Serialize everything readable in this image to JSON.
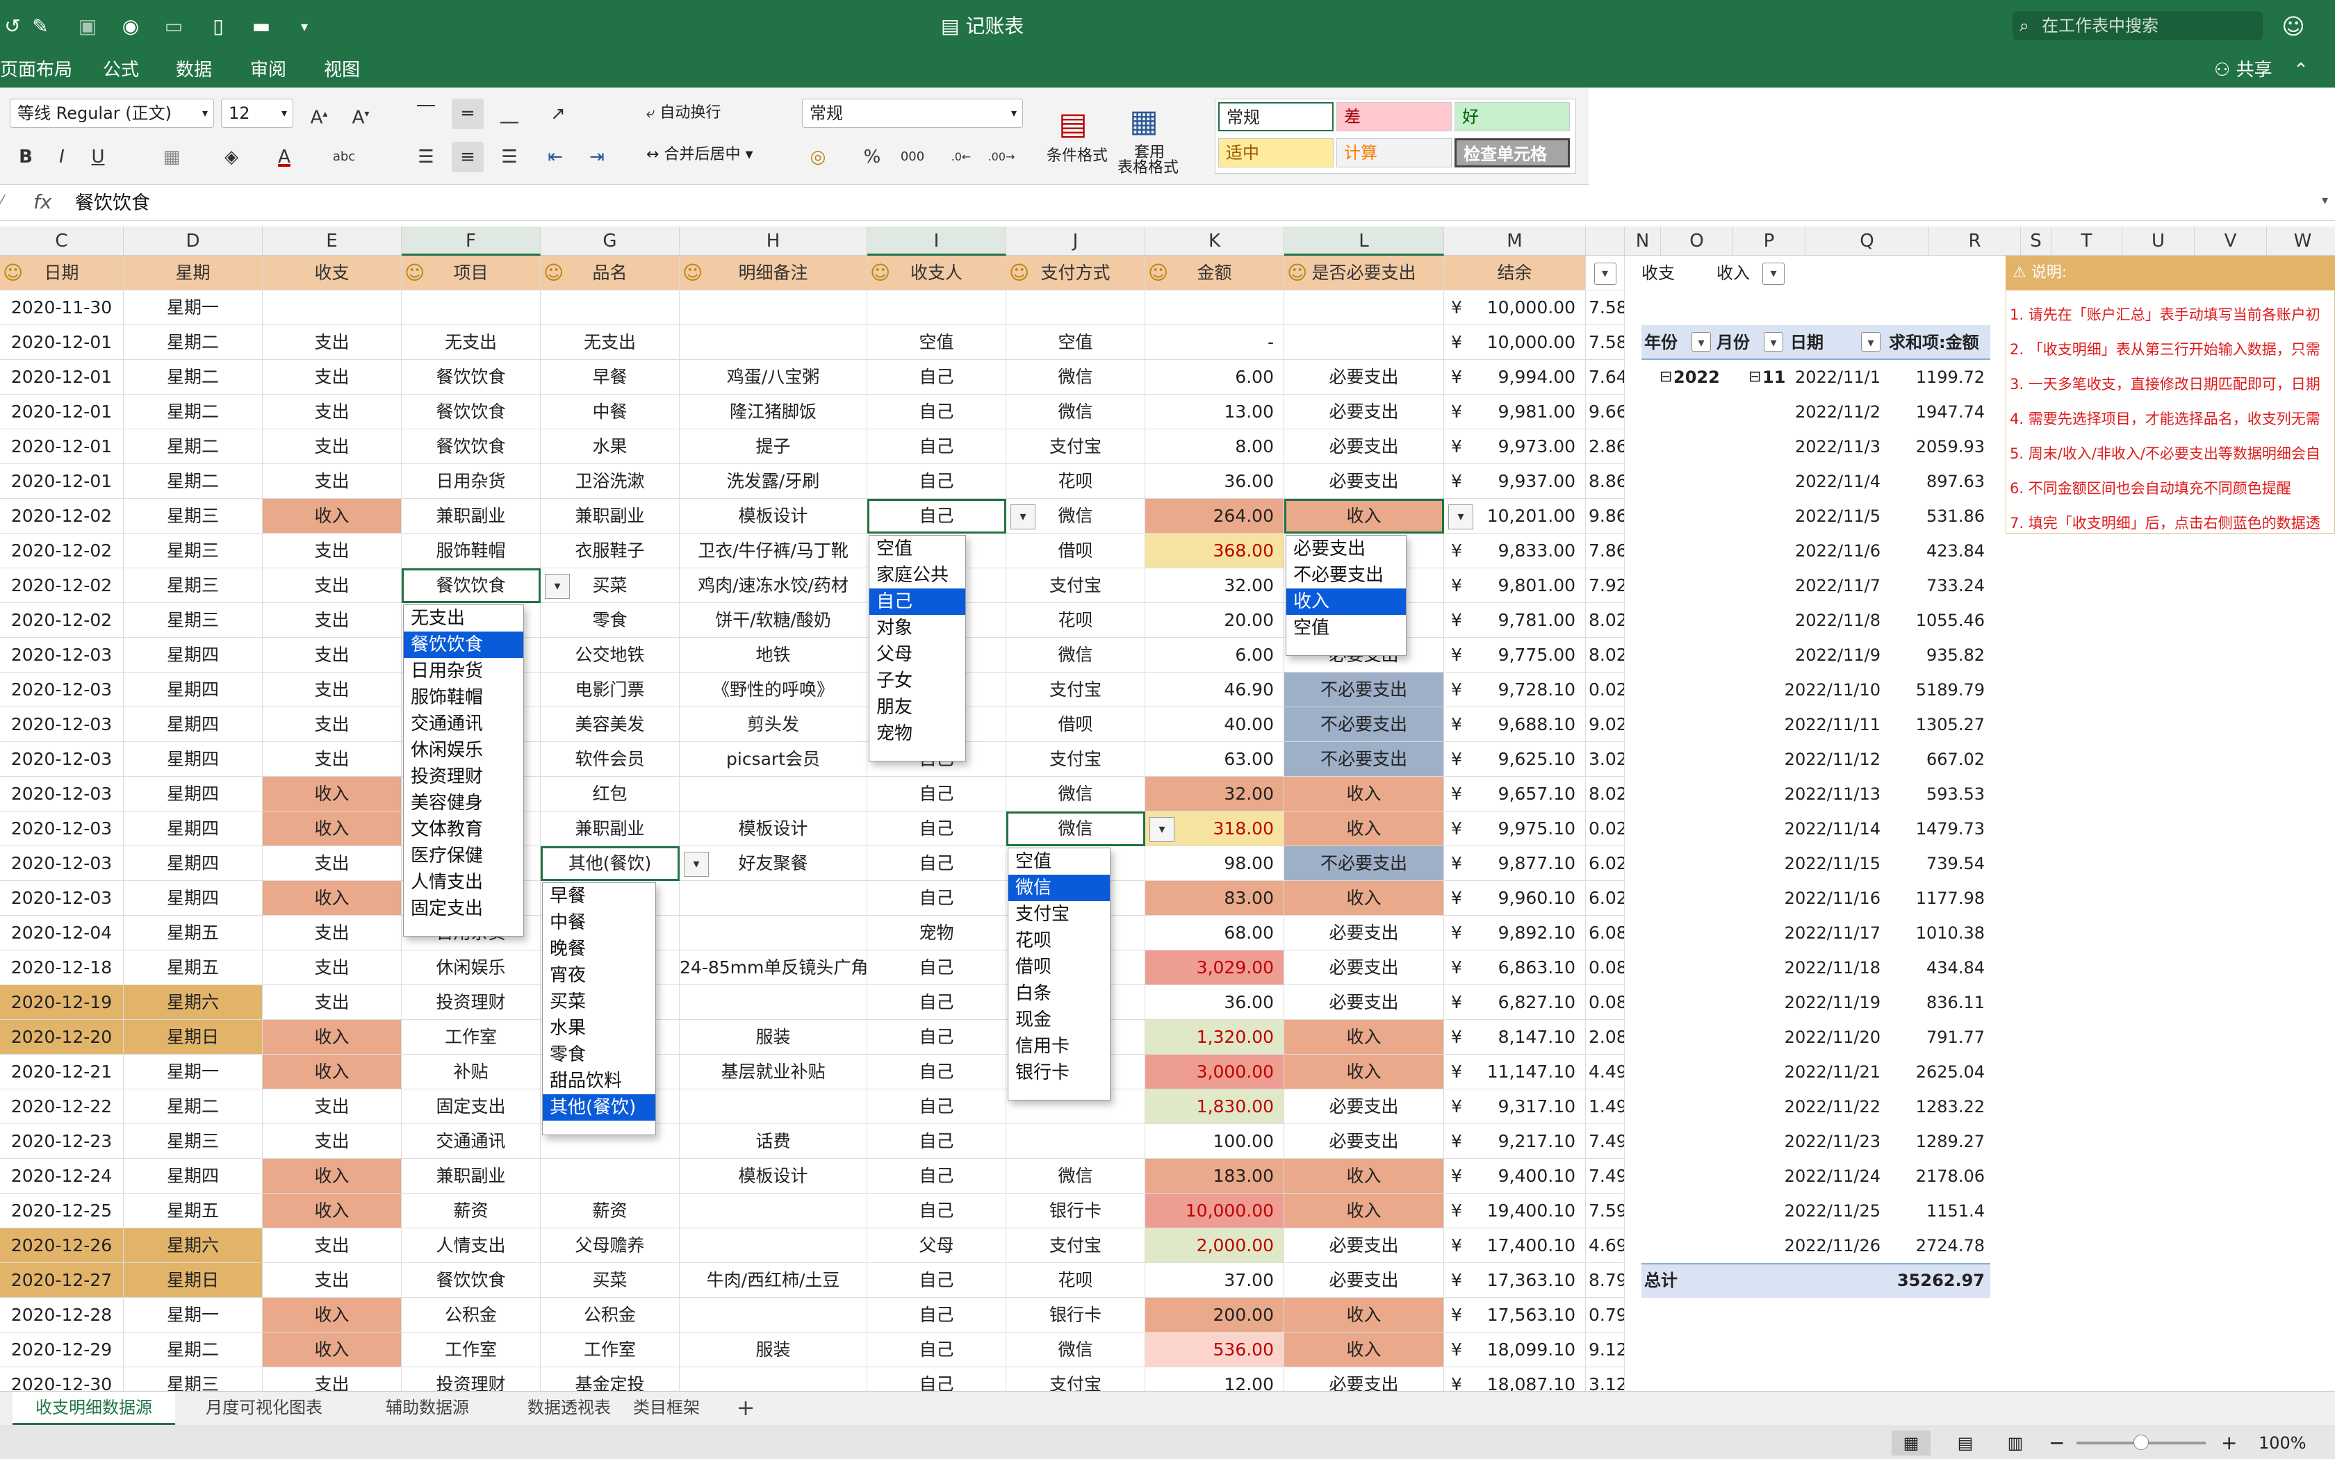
{
  "title": "记账表",
  "search_placeholder": "在工作表中搜索",
  "menus": [
    "页面布局",
    "公式",
    "数据",
    "审阅",
    "视图"
  ],
  "share": "共享",
  "ribbon": {
    "font_name": "等线 Regular (正文)",
    "font_size": "12",
    "wrap": "自动换行",
    "merge": "合并后居中",
    "number_format": "常规",
    "cond_format": "条件格式",
    "table_format_1": "套用",
    "table_format_2": "表格格式",
    "styles": [
      {
        "label": "常规",
        "bg": "#ffffff",
        "fg": "#222222"
      },
      {
        "label": "差",
        "bg": "#ffc7ce",
        "fg": "#9c0006"
      },
      {
        "label": "好",
        "bg": "#c6efce",
        "fg": "#006100"
      },
      {
        "label": "适中",
        "bg": "#ffeb9c",
        "fg": "#9c5700"
      },
      {
        "label": "计算",
        "bg": "#f2f2f2",
        "fg": "#fa7d00"
      },
      {
        "label": "检查单元格",
        "bg": "#a5a5a5",
        "fg": "#ffffff"
      }
    ]
  },
  "formula": {
    "fx": "fx",
    "value": "餐饮饮食"
  },
  "col_letters": [
    "C",
    "D",
    "E",
    "F",
    "G",
    "H",
    "I",
    "J",
    "K",
    "L",
    "M",
    "",
    "N",
    "O",
    "P",
    "Q",
    "R",
    "S",
    "T",
    "U",
    "V",
    "W"
  ],
  "headers": [
    "日期",
    "星期",
    "收支",
    "项目",
    "品名",
    "明细备注",
    "收支人",
    "支付方式",
    "金额",
    "是否必要支出",
    "结余"
  ],
  "colors": {
    "income": "#e9a98a",
    "weekend": "#e2b46a",
    "unneeded": "#9eb0c8",
    "green": "#217346",
    "sel": "#0a5bd9",
    "header": "#f2caa4"
  },
  "rows": [
    [
      "2020-11-30",
      "星期一",
      "",
      "",
      "",
      "",
      "",
      "",
      "",
      "",
      "10,000.00",
      "7.58",
      0,
      0,
      ""
    ],
    [
      "2020-12-01",
      "星期二",
      "支出",
      "无支出",
      "无支出",
      "",
      "空值",
      "空值",
      "-",
      "",
      "10,000.00",
      "7.58",
      0,
      0,
      ""
    ],
    [
      "2020-12-01",
      "星期二",
      "支出",
      "餐饮饮食",
      "早餐",
      "鸡蛋/八宝粥",
      "自己",
      "微信",
      "6.00",
      "必要支出",
      "9,994.00",
      "7.64",
      0,
      0,
      ""
    ],
    [
      "2020-12-01",
      "星期二",
      "支出",
      "餐饮饮食",
      "中餐",
      "隆江猪脚饭",
      "自己",
      "微信",
      "13.00",
      "必要支出",
      "9,981.00",
      "9.66",
      0,
      0,
      ""
    ],
    [
      "2020-12-01",
      "星期二",
      "支出",
      "餐饮饮食",
      "水果",
      "提子",
      "自己",
      "支付宝",
      "8.00",
      "必要支出",
      "9,973.00",
      "2.86",
      0,
      0,
      ""
    ],
    [
      "2020-12-01",
      "星期二",
      "支出",
      "日用杂货",
      "卫浴洗漱",
      "洗发露/牙刷",
      "自己",
      "花呗",
      "36.00",
      "必要支出",
      "9,937.00",
      "8.86",
      0,
      0,
      ""
    ],
    [
      "2020-12-02",
      "星期三",
      "收入",
      "兼职副业",
      "兼职副业",
      "模板设计",
      "自己",
      "微信",
      "264.00",
      "收入",
      "10,201.00",
      "9.86",
      1,
      0,
      "#e9a98a"
    ],
    [
      "2020-12-02",
      "星期三",
      "支出",
      "服饰鞋帽",
      "衣服鞋子",
      "卫衣/牛仔裤/马丁靴",
      "自己",
      "借呗",
      "368.00",
      "必要支出",
      "9,833.00",
      "7.86",
      0,
      0,
      "#f7e3a0"
    ],
    [
      "2020-12-02",
      "星期三",
      "支出",
      "餐饮饮食",
      "买菜",
      "鸡肉/速冻水饺/药材",
      "自己",
      "支付宝",
      "32.00",
      "必要支出",
      "9,801.00",
      "7.92",
      0,
      0,
      ""
    ],
    [
      "2020-12-02",
      "星期三",
      "支出",
      "零食",
      "零食",
      "饼干/软糖/酸奶",
      "自己",
      "花呗",
      "20.00",
      "必要支出",
      "9,781.00",
      "8.02",
      0,
      0,
      ""
    ],
    [
      "2020-12-03",
      "星期四",
      "支出",
      "交通通讯",
      "公交地铁",
      "地铁",
      "自己",
      "微信",
      "6.00",
      "必要支出",
      "9,775.00",
      "8.02",
      0,
      0,
      ""
    ],
    [
      "2020-12-03",
      "星期四",
      "支出",
      "休闲娱乐",
      "电影门票",
      "《野性的呼唤》",
      "自己",
      "支付宝",
      "46.90",
      "不必要支出",
      "9,728.10",
      "0.02",
      0,
      1,
      ""
    ],
    [
      "2020-12-03",
      "星期四",
      "支出",
      "美容健身",
      "美容美发",
      "剪头发",
      "自己",
      "借呗",
      "40.00",
      "不必要支出",
      "9,688.10",
      "9.02",
      0,
      1,
      ""
    ],
    [
      "2020-12-03",
      "星期四",
      "支出",
      "投资理财",
      "软件会员",
      "picsart会员",
      "自己",
      "支付宝",
      "63.00",
      "不必要支出",
      "9,625.10",
      "3.02",
      0,
      1,
      ""
    ],
    [
      "2020-12-03",
      "星期四",
      "收入",
      "人情支出",
      "红包",
      "",
      "自己",
      "微信",
      "32.00",
      "收入",
      "9,657.10",
      "8.02",
      1,
      0,
      "#e9a98a"
    ],
    [
      "2020-12-03",
      "星期四",
      "收入",
      "兼职副业",
      "兼职副业",
      "模板设计",
      "自己",
      "微信",
      "318.00",
      "收入",
      "9,975.10",
      "0.02",
      1,
      0,
      "#f7e3a0"
    ],
    [
      "2020-12-03",
      "星期四",
      "支出",
      "餐饮饮食",
      "其他(餐饮)",
      "好友聚餐",
      "自己",
      "",
      "98.00",
      "不必要支出",
      "9,877.10",
      "6.02",
      0,
      1,
      ""
    ],
    [
      "2020-12-03",
      "星期四",
      "收入",
      "医疗保健",
      "",
      "",
      "自己",
      "",
      "83.00",
      "收入",
      "9,960.10",
      "6.02",
      1,
      0,
      "#e9a98a"
    ],
    [
      "2020-12-04",
      "星期五",
      "支出",
      "日用杂货",
      "",
      "",
      "宠物",
      "",
      "68.00",
      "必要支出",
      "9,892.10",
      "6.08",
      0,
      0,
      ""
    ],
    [
      "2020-12-18",
      "星期五",
      "支出",
      "休闲娱乐",
      "",
      "24-85mm单反镜头广角",
      "自己",
      "",
      "3,029.00",
      "必要支出",
      "6,863.10",
      "0.08",
      0,
      0,
      "#ee9d93"
    ],
    [
      "2020-12-19",
      "星期六",
      "支出",
      "投资理财",
      "",
      "",
      "自己",
      "",
      "36.00",
      "必要支出",
      "6,827.10",
      "0.08",
      0,
      0,
      ""
    ],
    [
      "2020-12-20",
      "星期日",
      "收入",
      "工作室",
      "",
      "服装",
      "自己",
      "",
      "1,320.00",
      "收入",
      "8,147.10",
      "2.08",
      1,
      0,
      "#dfe9c8"
    ],
    [
      "2020-12-21",
      "星期一",
      "收入",
      "补贴",
      "",
      "基层就业补贴",
      "自己",
      "",
      "3,000.00",
      "收入",
      "11,147.10",
      "4.49",
      1,
      0,
      "#ee9d93"
    ],
    [
      "2020-12-22",
      "星期二",
      "支出",
      "固定支出",
      "",
      "",
      "自己",
      "",
      "1,830.00",
      "必要支出",
      "9,317.10",
      "1.49",
      0,
      0,
      "#dfe9c8"
    ],
    [
      "2020-12-23",
      "星期三",
      "支出",
      "交通通讯",
      "",
      "话费",
      "自己",
      "",
      "100.00",
      "必要支出",
      "9,217.10",
      "7.49",
      0,
      0,
      ""
    ],
    [
      "2020-12-24",
      "星期四",
      "收入",
      "兼职副业",
      "",
      "模板设计",
      "自己",
      "微信",
      "183.00",
      "收入",
      "9,400.10",
      "7.49",
      1,
      0,
      "#e9a98a"
    ],
    [
      "2020-12-25",
      "星期五",
      "收入",
      "薪资",
      "薪资",
      "",
      "自己",
      "银行卡",
      "10,000.00",
      "收入",
      "19,400.10",
      "7.59",
      1,
      0,
      "#ee9d93"
    ],
    [
      "2020-12-26",
      "星期六",
      "支出",
      "人情支出",
      "父母赡养",
      "",
      "父母",
      "支付宝",
      "2,000.00",
      "必要支出",
      "17,400.10",
      "4.69",
      0,
      0,
      "#dfe9c8"
    ],
    [
      "2020-12-27",
      "星期日",
      "支出",
      "餐饮饮食",
      "买菜",
      "牛肉/西红柿/土豆",
      "自己",
      "花呗",
      "37.00",
      "必要支出",
      "17,363.10",
      "8.79",
      0,
      0,
      ""
    ],
    [
      "2020-12-28",
      "星期一",
      "收入",
      "公积金",
      "公积金",
      "",
      "自己",
      "银行卡",
      "200.00",
      "收入",
      "17,563.10",
      "0.79",
      1,
      0,
      "#e9a98a"
    ],
    [
      "2020-12-29",
      "星期二",
      "收入",
      "工作室",
      "工作室",
      "服装",
      "自己",
      "微信",
      "536.00",
      "收入",
      "18,099.10",
      "9.12",
      1,
      0,
      "#fbd5cc"
    ],
    [
      "2020-12-30",
      "星期三",
      "支出",
      "投资理财",
      "基金定投",
      "",
      "自己",
      "支付宝",
      "12.00",
      "必要支出",
      "18,087.10",
      "3.12",
      0,
      0,
      ""
    ]
  ],
  "dropdowns": {
    "project": {
      "items": [
        "无支出",
        "餐饮饮食",
        "日用杂货",
        "服饰鞋帽",
        "交通通讯",
        "休闲娱乐",
        "投资理财",
        "美容健身",
        "文体教育",
        "医疗保健",
        "人情支出",
        "固定支出"
      ],
      "selected": 1,
      "current": "餐饮饮食"
    },
    "person": {
      "items": [
        "空值",
        "家庭公共",
        "自己",
        "对象",
        "父母",
        "子女",
        "朋友",
        "宠物"
      ],
      "selected": 2,
      "current": "自己"
    },
    "necessary": {
      "items": [
        "必要支出",
        "不必要支出",
        "收入",
        "空值"
      ],
      "selected": 2,
      "current": "收入"
    },
    "product": {
      "items": [
        "早餐",
        "中餐",
        "晚餐",
        "宵夜",
        "买菜",
        "水果",
        "零食",
        "甜品饮料",
        "其他(餐饮)"
      ],
      "selected": 8,
      "current": "其他(餐饮)"
    },
    "payment": {
      "items": [
        "空值",
        "微信",
        "支付宝",
        "花呗",
        "借呗",
        "白条",
        "现金",
        "信用卡",
        "银行卡"
      ],
      "selected": 1,
      "current": "微信"
    }
  },
  "pivot": {
    "filter_label": "收支",
    "filter_value": "收入",
    "h_year": "年份",
    "h_month": "月份",
    "h_date": "日期",
    "h_sum": "求和项:金额",
    "year": "2022",
    "month": "11",
    "rows": [
      [
        "2022/11/1",
        "1199.72"
      ],
      [
        "2022/11/2",
        "1947.74"
      ],
      [
        "2022/11/3",
        "2059.93"
      ],
      [
        "2022/11/4",
        "897.63"
      ],
      [
        "2022/11/5",
        "531.86"
      ],
      [
        "2022/11/6",
        "423.84"
      ],
      [
        "2022/11/7",
        "733.24"
      ],
      [
        "2022/11/8",
        "1055.46"
      ],
      [
        "2022/11/9",
        "935.82"
      ],
      [
        "2022/11/10",
        "5189.79"
      ],
      [
        "2022/11/11",
        "1305.27"
      ],
      [
        "2022/11/12",
        "667.02"
      ],
      [
        "2022/11/13",
        "593.53"
      ],
      [
        "2022/11/14",
        "1479.73"
      ],
      [
        "2022/11/15",
        "739.54"
      ],
      [
        "2022/11/16",
        "1177.98"
      ],
      [
        "2022/11/17",
        "1010.38"
      ],
      [
        "2022/11/18",
        "434.84"
      ],
      [
        "2022/11/19",
        "836.11"
      ],
      [
        "2022/11/20",
        "791.77"
      ],
      [
        "2022/11/21",
        "2625.04"
      ],
      [
        "2022/11/22",
        "1283.22"
      ],
      [
        "2022/11/23",
        "1289.27"
      ],
      [
        "2022/11/24",
        "2178.06"
      ],
      [
        "2022/11/25",
        "1151.4"
      ],
      [
        "2022/11/26",
        "2724.78"
      ]
    ],
    "total_label": "总计",
    "total": "35262.97"
  },
  "notes": {
    "title": "说明:",
    "lines": [
      "1. 请先在「账户汇总」表手动填写当前各账户初",
      "2. 「收支明细」表从第三行开始输入数据，只需",
      "3. 一天多笔收支，直接修改日期匹配即可，日期",
      "4. 需要先选择项目，才能选择品名，收支列无需",
      "5. 周末/收入/非收入/不必要支出等数据明细会自",
      "6. 不同金额区间也会自动填充不同颜色提醒",
      "7. 填完「收支明细」后，点击右侧蓝色的数据透"
    ]
  },
  "sheet_tabs": [
    "收支明细数据源",
    "月度可视化图表",
    "辅助数据源",
    "数据透视表",
    "类目框架"
  ],
  "add_sheet": "+",
  "zoom": "100%"
}
